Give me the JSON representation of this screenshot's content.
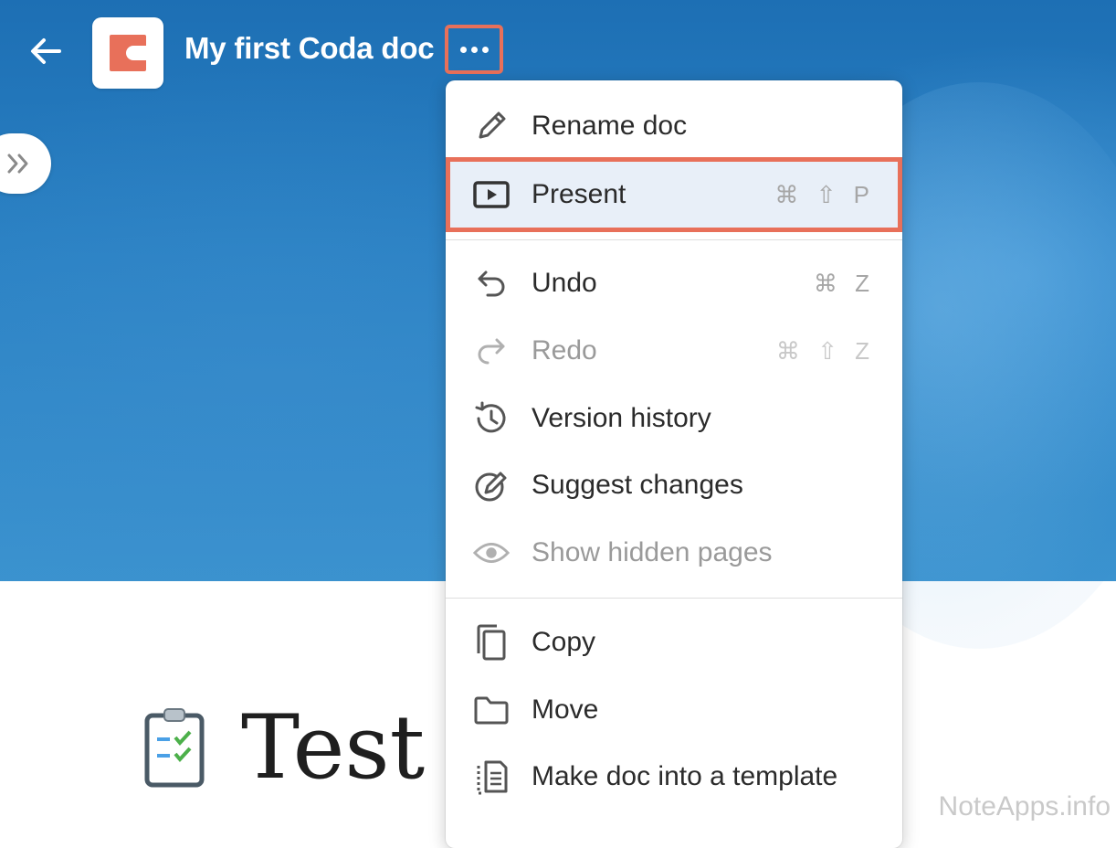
{
  "header": {
    "title": "My first Coda doc",
    "brand_color": "#e8705a",
    "background": "#2b82c4"
  },
  "icons": {
    "back": "arrow-left-icon",
    "logo": "coda-logo-icon",
    "more": "more-horizontal-icon",
    "sidebar": "double-chevron-right-icon",
    "page_emoji": "clipboard-checklist-icon"
  },
  "menu": {
    "items": [
      {
        "label": "Rename doc",
        "icon": "pencil-icon",
        "shortcut": ""
      },
      {
        "label": "Present",
        "icon": "present-icon",
        "shortcut": "⌘ ⇧ P"
      },
      {
        "label": "Undo",
        "icon": "undo-icon",
        "shortcut": "⌘ Z"
      },
      {
        "label": "Redo",
        "icon": "redo-icon",
        "shortcut": "⌘ ⇧ Z"
      },
      {
        "label": "Version history",
        "icon": "history-icon",
        "shortcut": ""
      },
      {
        "label": "Suggest changes",
        "icon": "suggest-changes-icon",
        "shortcut": ""
      },
      {
        "label": "Show hidden pages",
        "icon": "eye-icon",
        "shortcut": ""
      },
      {
        "label": "Copy",
        "icon": "copy-icon",
        "shortcut": ""
      },
      {
        "label": "Move",
        "icon": "folder-icon",
        "shortcut": ""
      },
      {
        "label": "Make doc into a template",
        "icon": "template-icon",
        "shortcut": ""
      }
    ],
    "highlight_color": "#e8705a"
  },
  "page": {
    "title": "Test I"
  },
  "watermark": "NoteApps.info"
}
